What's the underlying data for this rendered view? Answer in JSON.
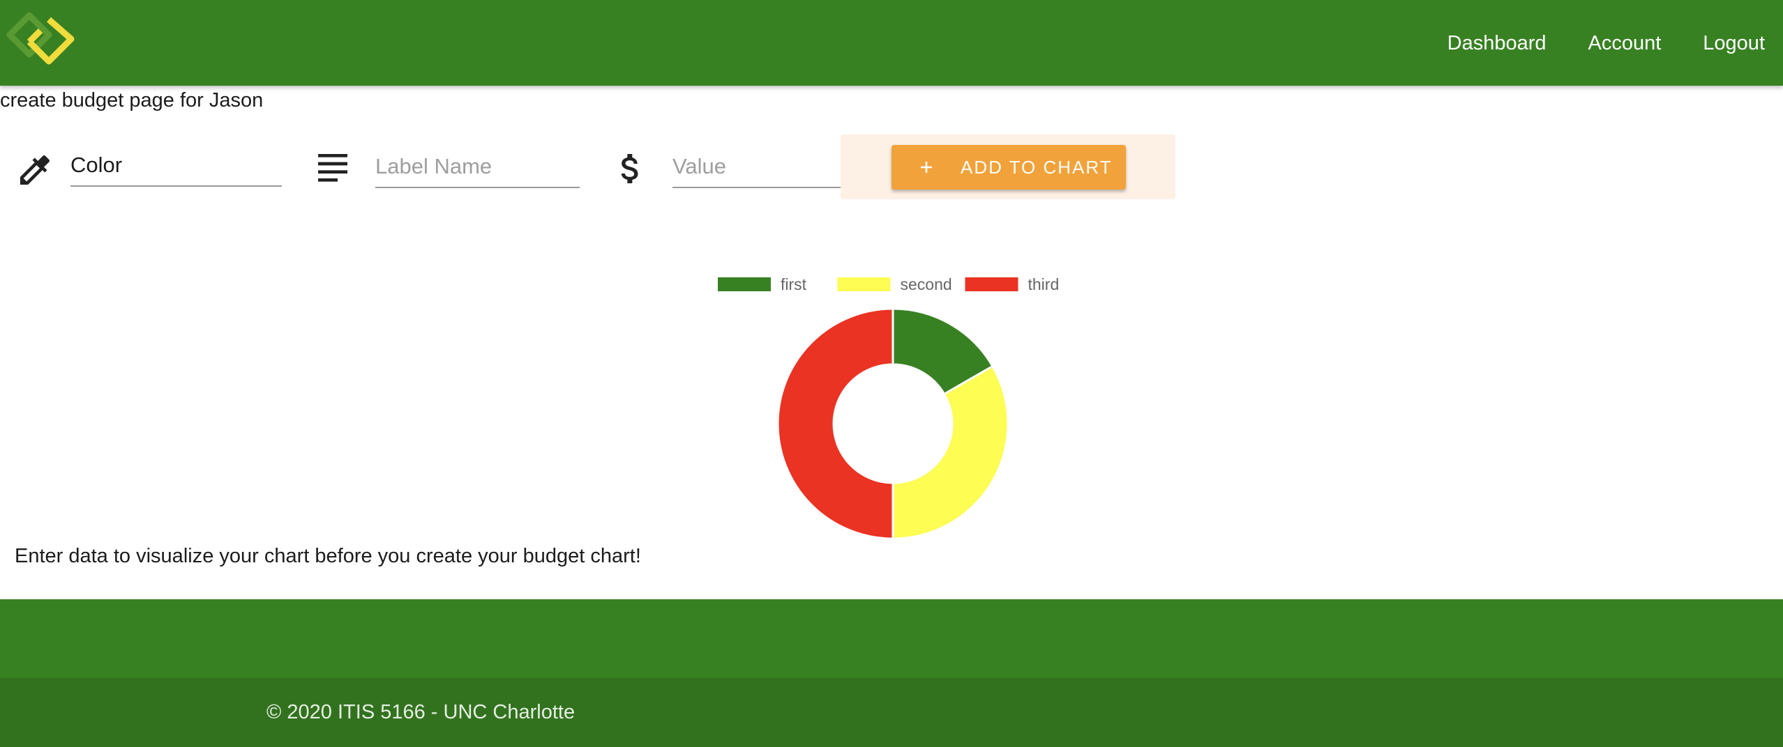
{
  "header": {
    "logo_icon": "diamond-logo-icon",
    "nav": {
      "dashboard": "Dashboard",
      "account": "Account",
      "logout": "Logout"
    }
  },
  "page": {
    "heading": "create budget page for Jason"
  },
  "form": {
    "color_icon": "eyedropper-icon",
    "color_value": "Color",
    "label_icon": "text-lines-icon",
    "label_placeholder": "Label Name",
    "value_icon": "dollar-icon",
    "value_placeholder": "Value",
    "add_icon": "plus-icon",
    "add_button_label": "ADD TO CHART"
  },
  "chart_data": {
    "type": "doughnut",
    "legend_position": "top",
    "series": [
      {
        "name": "first",
        "value": 1,
        "color": "#388123"
      },
      {
        "name": "second",
        "value": 2,
        "color": "#fdfd54"
      },
      {
        "name": "third",
        "value": 3,
        "color": "#ea3323"
      }
    ]
  },
  "hint": "Enter data to visualize your chart before you create your budget chart!",
  "footer": {
    "copyright": "© 2020 ITIS 5166 - UNC Charlotte"
  },
  "colors": {
    "brand_green": "#388123",
    "footer_dark_green": "#32721f",
    "accent_orange": "#f2a23a",
    "panel_peach": "#fdf0e4"
  }
}
